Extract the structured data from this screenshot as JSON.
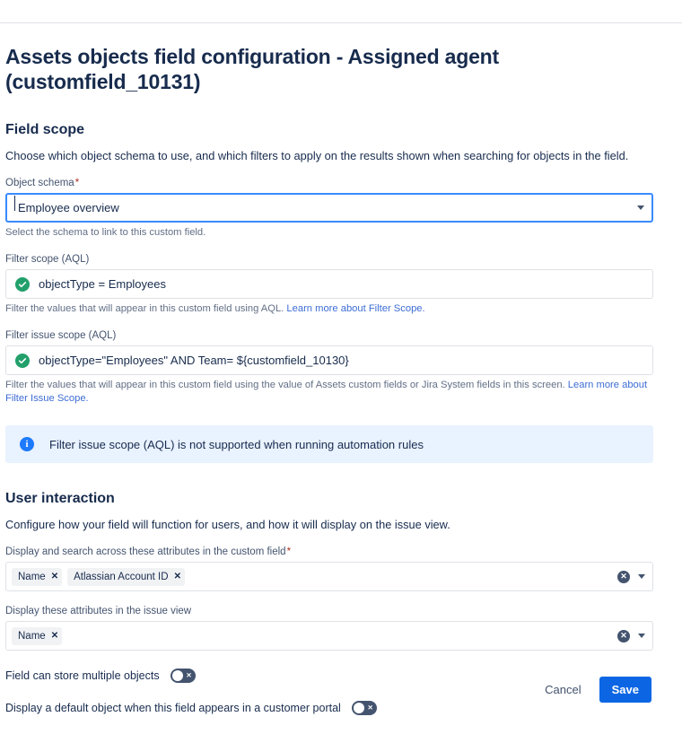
{
  "page": {
    "title": "Assets objects field configuration - Assigned agent (customfield_10131)"
  },
  "field_scope": {
    "heading": "Field scope",
    "description": "Choose which object schema to use, and which filters to apply on the results shown when searching for objects in the field.",
    "object_schema": {
      "label": "Object schema",
      "required_marker": "*",
      "value": "Employee overview",
      "helper": "Select the schema to link to this custom field."
    },
    "filter_scope": {
      "label": "Filter scope (AQL)",
      "value": "objectType = Employees",
      "status_icon": "check-circle-icon",
      "helper_text": "Filter the values that will appear in this custom field using AQL.",
      "helper_link": "Learn more about Filter Scope."
    },
    "filter_issue_scope": {
      "label": "Filter issue scope (AQL)",
      "value": "objectType=\"Employees\" AND Team= ${customfield_10130}",
      "status_icon": "check-circle-icon",
      "helper_text": "Filter the values that will appear in this custom field using the value of Assets custom fields or Jira System fields in this screen.",
      "helper_link": "Learn more about Filter Issue Scope."
    },
    "info_banner": {
      "icon": "info-icon",
      "text": "Filter issue scope (AQL) is not supported when running automation rules"
    }
  },
  "user_interaction": {
    "heading": "User interaction",
    "description": "Configure how your field will function for users, and how it will display on the issue view.",
    "display_search_attributes": {
      "label": "Display and search across these attributes in the custom field",
      "required_marker": "*",
      "tags": [
        "Name",
        "Atlassian Account ID"
      ],
      "remove_glyph": "✕",
      "clear_glyph": "✕"
    },
    "issue_view_attributes": {
      "label": "Display these attributes in the issue view",
      "tags": [
        "Name"
      ],
      "remove_glyph": "✕",
      "clear_glyph": "✕"
    },
    "toggles": [
      {
        "label": "Field can store multiple objects",
        "state": "off",
        "glyph": "✕"
      },
      {
        "label": "Display a default object when this field appears in a customer portal",
        "state": "off",
        "glyph": "✕"
      }
    ]
  },
  "footer": {
    "cancel_label": "Cancel",
    "save_label": "Save"
  },
  "colors": {
    "primary": "#0C66E4",
    "success": "#22A06B",
    "info": "#1D7AFC",
    "focus_border": "#388BFF",
    "link": "#3D6DD4"
  }
}
